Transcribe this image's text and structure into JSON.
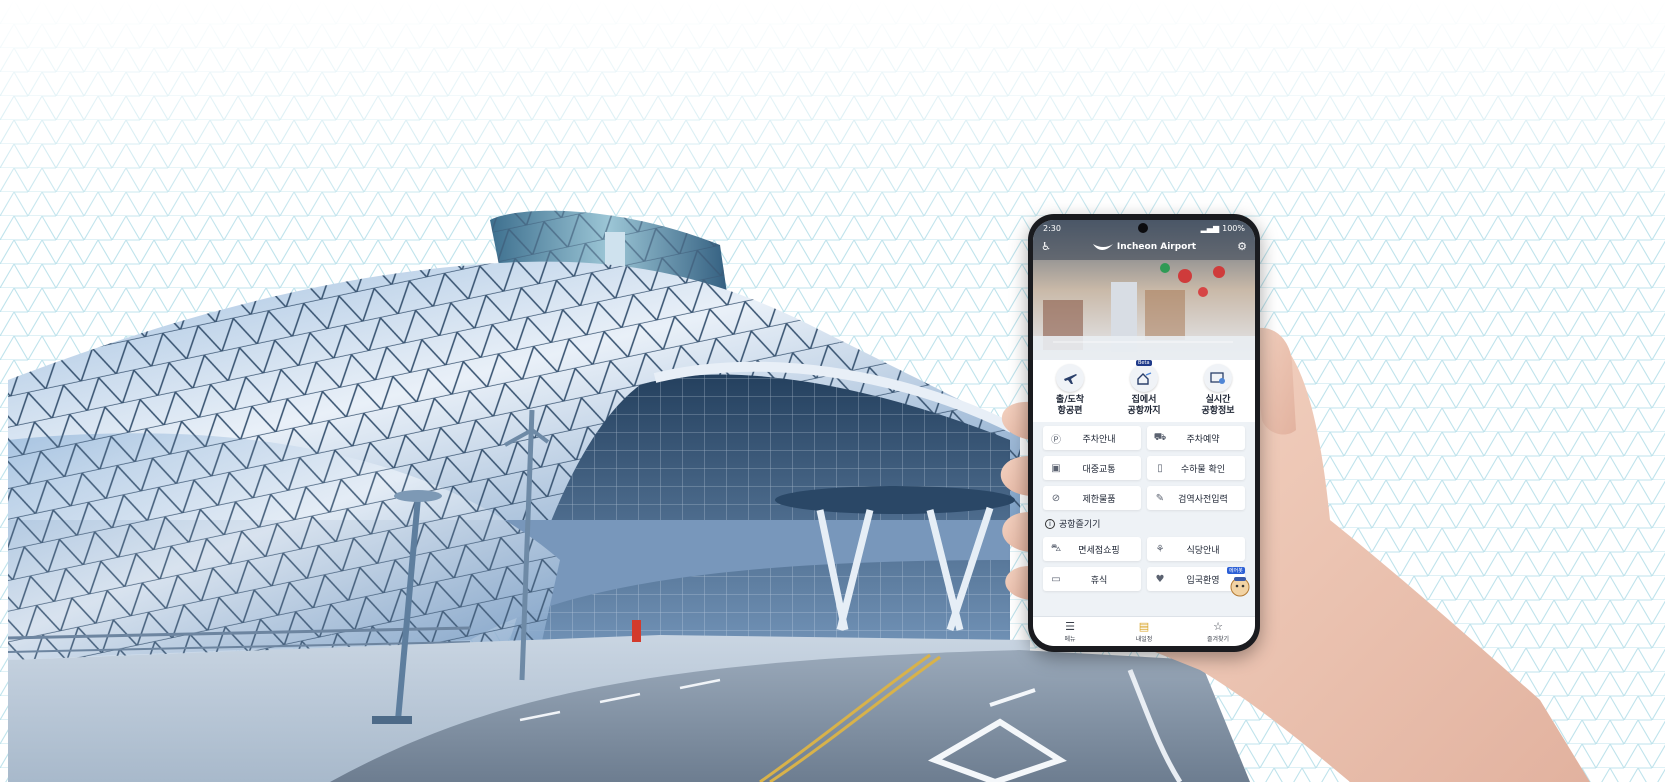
{
  "status_bar": {
    "time": "2:30",
    "battery": "100%"
  },
  "app_header": {
    "logo_text": "Incheon Airport"
  },
  "quick_menu": [
    {
      "label_line1": "출/도착",
      "label_line2": "항공편",
      "icon": "airplane-icon"
    },
    {
      "label_line1": "집에서",
      "label_line2": "공항까지",
      "icon": "home-to-airport-icon",
      "badge": "Beta"
    },
    {
      "label_line1": "실시간",
      "label_line2": "공항정보",
      "icon": "realtime-info-icon"
    }
  ],
  "service_grid": [
    {
      "label": "주차안내",
      "icon": "parking-icon"
    },
    {
      "label": "주차예약",
      "icon": "car-icon"
    },
    {
      "label": "대중교통",
      "icon": "bus-icon"
    },
    {
      "label": "수하물 확인",
      "icon": "baggage-icon"
    },
    {
      "label": "제한물품",
      "icon": "restricted-icon"
    },
    {
      "label": "검역사전입력",
      "icon": "quarantine-icon"
    }
  ],
  "enjoy_section": {
    "title": "공항즐기기",
    "items": [
      {
        "label": "면세점쇼핑",
        "icon": "shopping-cart-icon"
      },
      {
        "label": "식당안내",
        "icon": "restaurant-icon"
      },
      {
        "label": "휴식",
        "icon": "rest-icon"
      },
      {
        "label": "입국환영",
        "icon": "welcome-icon"
      }
    ]
  },
  "assistant_badge": "에어봇",
  "bottom_tabs": [
    {
      "label": "메뉴",
      "icon": "menu-icon"
    },
    {
      "label": "내일정",
      "icon": "calendar-icon"
    },
    {
      "label": "즐겨찾기",
      "icon": "star-icon"
    }
  ]
}
